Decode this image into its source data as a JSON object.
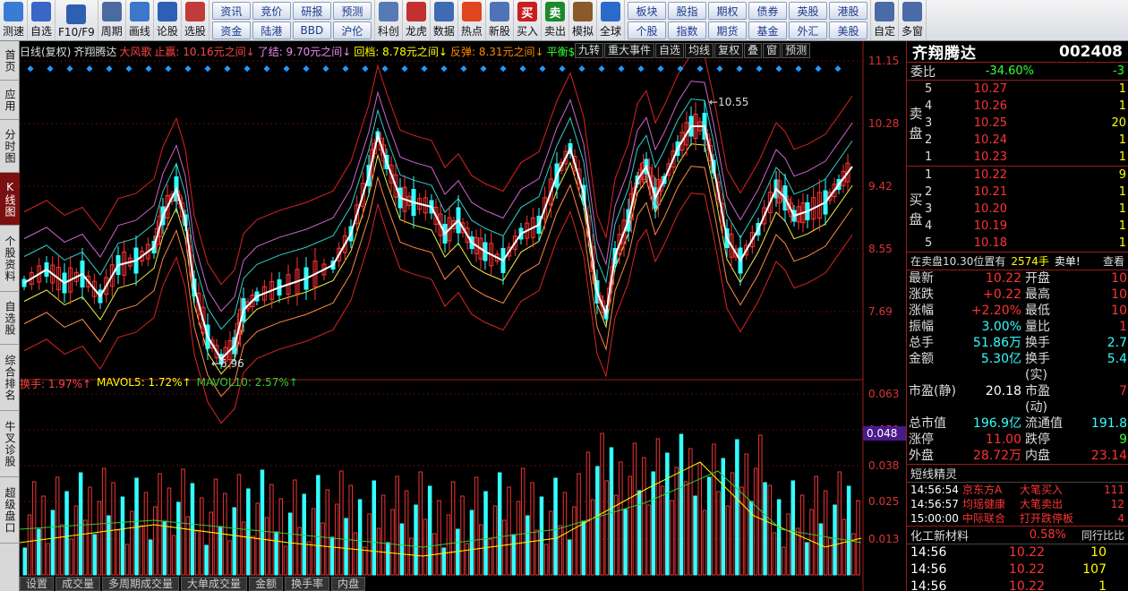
{
  "toolbar": {
    "big": [
      {
        "label": "测速",
        "icon": "speed-icon",
        "c": "#3a7bd5"
      },
      {
        "label": "自选",
        "icon": "star-icon",
        "c": "#3a66c8"
      },
      {
        "label": "F10/F9",
        "icon": "f10-icon",
        "c": "#2f5fb0"
      },
      {
        "label": "周期",
        "icon": "clock-icon",
        "c": "#4b6ba0"
      },
      {
        "label": "画线",
        "icon": "pen-icon",
        "c": "#3c77c9"
      },
      {
        "label": "论股",
        "icon": "talk-icon",
        "c": "#2d5fb5"
      },
      {
        "label": "选股",
        "icon": "search-chart-icon",
        "c": "#c23b3b"
      }
    ],
    "grid": [
      "资讯",
      "资金",
      "竞价",
      "陆港",
      "研报",
      "BBD",
      "预测",
      "沪伦"
    ],
    "mid": [
      {
        "label": "科创",
        "icon": "chart-icon",
        "c": "#557ab5"
      },
      {
        "label": "龙虎",
        "icon": "tiger-icon",
        "c": "#c23030"
      },
      {
        "label": "数据",
        "icon": "pe-icon",
        "c": "#3f6bb2"
      },
      {
        "label": "热点",
        "icon": "hot-icon",
        "c": "#e04520"
      },
      {
        "label": "新股",
        "icon": "ipo-icon",
        "c": "#4f73b8"
      },
      {
        "label": "买入",
        "icon": "buy-icon",
        "c": "#c81e1e",
        "t": "买"
      },
      {
        "label": "卖出",
        "icon": "sell-icon",
        "c": "#1a8a2a",
        "t": "卖"
      },
      {
        "label": "模拟",
        "icon": "hammer-icon",
        "c": "#8a5a2a"
      },
      {
        "label": "全球",
        "icon": "globe-icon",
        "c": "#2a6ac8"
      }
    ],
    "grid2": [
      "板块",
      "个股",
      "股指",
      "指数",
      "期权",
      "期货",
      "债券",
      "基金",
      "英股",
      "外汇",
      "港股",
      "美股"
    ],
    "right": [
      {
        "label": "自定",
        "icon": "custom-icon",
        "c": "#4a6aa8"
      },
      {
        "label": "多窗",
        "icon": "windows-icon",
        "c": "#4a6aa8"
      }
    ]
  },
  "left_tabs": [
    {
      "label": "首页",
      "active": false
    },
    {
      "label": "应用",
      "active": false
    },
    {
      "label": "分时图",
      "active": false
    },
    {
      "label": "K线图",
      "active": true
    },
    {
      "label": "个股资料",
      "active": false
    },
    {
      "label": "自选股",
      "active": false
    },
    {
      "label": "综合排名",
      "active": false
    },
    {
      "label": "牛叉诊股",
      "active": false
    },
    {
      "label": "超级盘口",
      "active": false
    }
  ],
  "infobar": [
    {
      "t": "日线(复权)",
      "c": "#ddd"
    },
    {
      "t": "齐翔腾达",
      "c": "#ddd"
    },
    {
      "t": "大风歌",
      "c": "#f44"
    },
    {
      "t": "止赢: 10.16元之间↓",
      "c": "#f44"
    },
    {
      "t": "了结: 9.70元之间↓",
      "c": "#e8e"
    },
    {
      "t": "回档: 8.78元之间↓",
      "c": "#ff0"
    },
    {
      "t": "反弹: 8.31元之间↓",
      "c": "#f80"
    },
    {
      "t": "平衡$",
      "c": "#3f3"
    }
  ],
  "chart_tools": [
    "九转",
    "重大事件",
    "自选",
    "均线",
    "复权",
    "叠",
    "窗",
    "预测"
  ],
  "price_axis": [
    "11.15",
    "10.28",
    "9.42",
    "8.55",
    "7.69"
  ],
  "vol_axis": [
    "0.063",
    "0.050",
    "0.038",
    "0.025",
    "0.013"
  ],
  "vol_current": "0.048",
  "markers": {
    "high": "10.55",
    "low": "6.96"
  },
  "volbar": [
    {
      "t": "换手: 1.97%↑",
      "c": "#f44"
    },
    {
      "t": "MAVOL5: 1.72%↑",
      "c": "#ff0"
    },
    {
      "t": "MAVOL10: 2.57%↑",
      "c": "#3c3"
    }
  ],
  "bottom_tabs": [
    "设置",
    "成交量",
    "多周期成交量",
    "大单成交量",
    "金额",
    "换手率",
    "内盘"
  ],
  "quote": {
    "name": "齐翔腾达",
    "code": "002408",
    "webi_label": "委比",
    "webi": "-34.60%",
    "webi2": "-3",
    "sell_label": [
      "卖",
      "盘"
    ],
    "buy_label": [
      "买",
      "盘"
    ],
    "sell": [
      {
        "lv": "5",
        "p": "10.27",
        "v": "1"
      },
      {
        "lv": "4",
        "p": "10.26",
        "v": "1"
      },
      {
        "lv": "3",
        "p": "10.25",
        "v": "20"
      },
      {
        "lv": "2",
        "p": "10.24",
        "v": "1"
      },
      {
        "lv": "1",
        "p": "10.23",
        "v": "1"
      }
    ],
    "buy": [
      {
        "lv": "1",
        "p": "10.22",
        "v": "9"
      },
      {
        "lv": "2",
        "p": "10.21",
        "v": "1"
      },
      {
        "lv": "3",
        "p": "10.20",
        "v": "1"
      },
      {
        "lv": "4",
        "p": "10.19",
        "v": "1"
      },
      {
        "lv": "5",
        "p": "10.18",
        "v": "1"
      }
    ],
    "sell_note": "在卖盘10.30位置有",
    "sell_note_v": "2574手",
    "sell_note_t": "卖单!",
    "sell_note_btn": "查看",
    "stats": [
      [
        "最新",
        "10.22",
        "开盘",
        "10"
      ],
      [
        "涨跌",
        "+0.22",
        "最高",
        "10"
      ],
      [
        "涨幅",
        "+2.20%",
        "最低",
        "10"
      ],
      [
        "振幅",
        "3.00%",
        "量比",
        "1"
      ],
      [
        "总手",
        "51.86万",
        "换手",
        "2.7"
      ],
      [
        "金额",
        "5.30亿",
        "换手(实)",
        "5.4"
      ],
      [
        "市盈(静)",
        "20.18",
        "市盈(动)",
        "7"
      ],
      [
        "总市值",
        "196.9亿",
        "流通值",
        "191.8"
      ],
      [
        "涨停",
        "11.00",
        "跌停",
        "9"
      ],
      [
        "外盘",
        "28.72万",
        "内盘",
        "23.14"
      ]
    ],
    "spirit_title": "短线精灵",
    "spirit": [
      [
        "14:56:54",
        "京东方A",
        "大笔买入",
        "111"
      ],
      [
        "14:56:57",
        "均瑶健康",
        "大笔卖出",
        "12"
      ],
      [
        "15:00:00",
        "中际联合",
        "打开跌停板",
        "4"
      ]
    ],
    "sector": "化工新材料",
    "sector_pct": "0.58%",
    "sector_btn": "同行比比",
    "ticks": [
      [
        "14:56",
        "10.22",
        "10"
      ],
      [
        "14:56",
        "10.22",
        "107"
      ],
      [
        "14:56",
        "10.22",
        "1"
      ],
      [
        "14:56",
        "10.22",
        "1"
      ]
    ]
  }
}
